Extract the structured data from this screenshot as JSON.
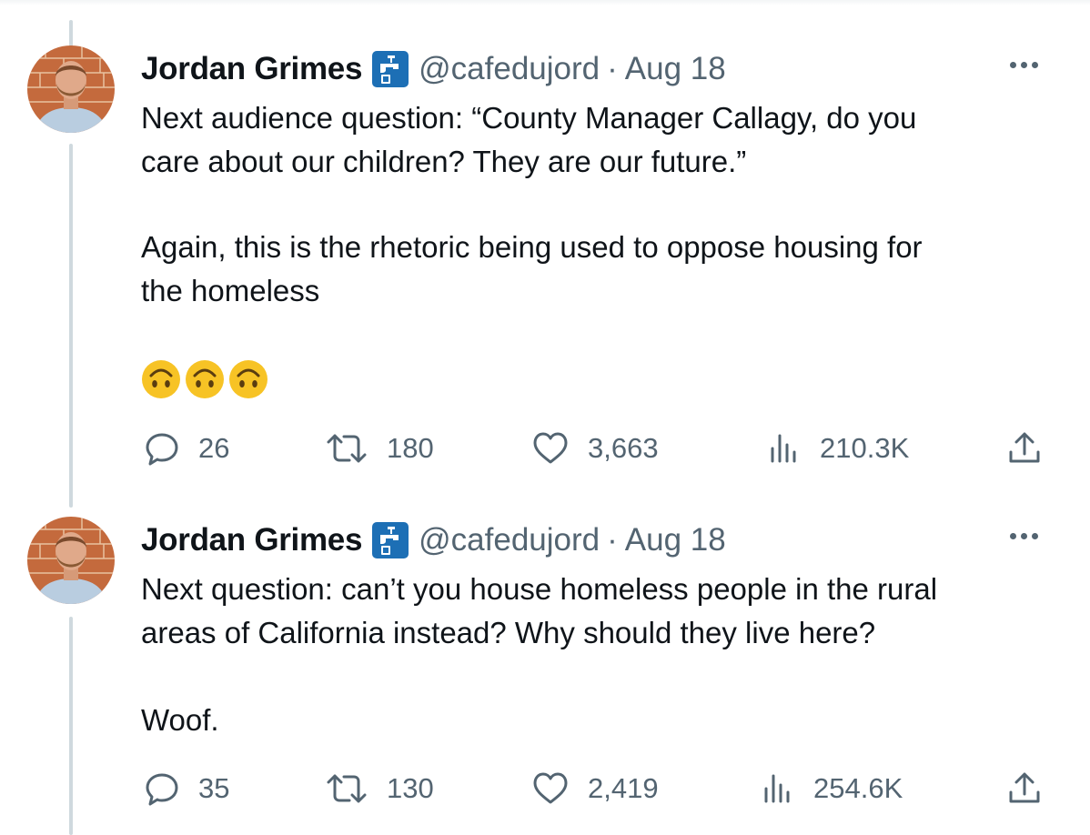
{
  "tweets": [
    {
      "author": {
        "name": "Jordan Grimes",
        "handle": "@cafedujord",
        "badge_icon": "water-tap-icon"
      },
      "date": "Aug 18",
      "dot": "·",
      "text": [
        "Next audience question: “County Manager Callagy, do you",
        "care about our children?  They are our future.”",
        "Again, this is the rhetoric being used to oppose housing for",
        "the homeless"
      ],
      "emojis": [
        "upside-down-face",
        "upside-down-face",
        "upside-down-face"
      ],
      "stats": {
        "replies": "26",
        "retweets": "180",
        "likes": "3,663",
        "views": "210.3K"
      }
    },
    {
      "author": {
        "name": "Jordan Grimes",
        "handle": "@cafedujord",
        "badge_icon": "water-tap-icon"
      },
      "date": "Aug 18",
      "dot": "·",
      "text": [
        "Next question: can’t you house homeless people in the rural",
        "areas of California instead?  Why should they live here?",
        "Woof."
      ],
      "stats": {
        "replies": "35",
        "retweets": "130",
        "likes": "2,419",
        "views": "254.6K"
      }
    }
  ],
  "colors": {
    "text_primary": "#0f1419",
    "text_secondary": "#536471",
    "thread_line": "#cfd9de",
    "badge_blue": "#1d6fb5",
    "emoji_yellow": "#f7c325"
  }
}
